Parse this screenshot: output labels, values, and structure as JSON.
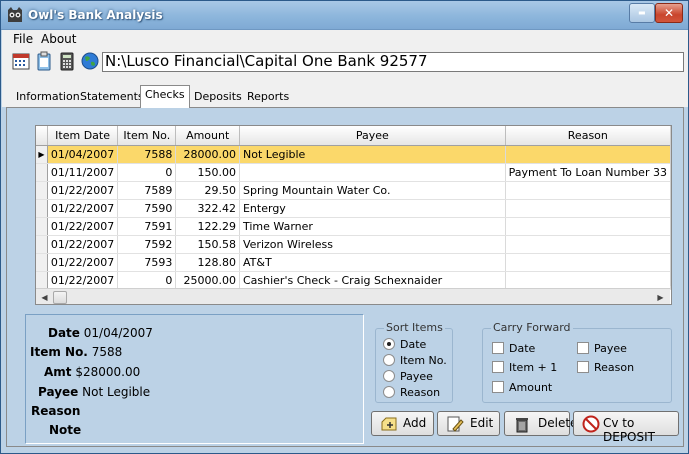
{
  "window": {
    "title": "Owl's Bank Analysis",
    "minimize_glyph": "▬",
    "close_glyph": "✕"
  },
  "menu": {
    "file": "File",
    "about": "About"
  },
  "toolbar": {
    "path": "N:\\Lusco Financial\\Capital One Bank 92577",
    "icons": [
      "calendar-icon",
      "clipboard-icon",
      "calculator-icon",
      "globe-icon"
    ]
  },
  "tabs": [
    "Information",
    "Statements",
    "Checks",
    "Deposits",
    "Reports"
  ],
  "active_tab": "Checks",
  "grid": {
    "columns": [
      "Item Date",
      "Item No.",
      "Amount",
      "Payee",
      "Reason"
    ],
    "selected_marker": "▶",
    "rows": [
      {
        "date": "01/04/2007",
        "no": "7588",
        "amount": "28000.00",
        "payee": "Not Legible",
        "reason": ""
      },
      {
        "date": "01/11/2007",
        "no": "0",
        "amount": "150.00",
        "payee": "",
        "reason": "Payment To Loan Number 33"
      },
      {
        "date": "01/22/2007",
        "no": "7589",
        "amount": "29.50",
        "payee": "Spring Mountain Water Co.",
        "reason": ""
      },
      {
        "date": "01/22/2007",
        "no": "7590",
        "amount": "322.42",
        "payee": "Entergy",
        "reason": ""
      },
      {
        "date": "01/22/2007",
        "no": "7591",
        "amount": "122.29",
        "payee": "Time Warner",
        "reason": ""
      },
      {
        "date": "01/22/2007",
        "no": "7592",
        "amount": "150.58",
        "payee": "Verizon Wireless",
        "reason": ""
      },
      {
        "date": "01/22/2007",
        "no": "7593",
        "amount": "128.80",
        "payee": "AT&T",
        "reason": ""
      },
      {
        "date": "01/22/2007",
        "no": "0",
        "amount": "25000.00",
        "payee": "Cashier's Check - Craig Schexnaider",
        "reason": ""
      }
    ],
    "scroll_up": "▲",
    "scroll_down": "▼",
    "scroll_left": "◀",
    "scroll_right": "▶"
  },
  "detail": {
    "date_label": "Date",
    "date_value": "01/04/2007",
    "item_label": "Item No.",
    "item_value": "7588",
    "amt_label": "Amt",
    "amt_value": "$28000.00",
    "payee_label": "Payee",
    "payee_value": "Not Legible",
    "reason_label": "Reason",
    "note_label": "Note"
  },
  "sort_items": {
    "title": "Sort Items",
    "options": [
      "Date",
      "Item No.",
      "Payee",
      "Reason"
    ],
    "selected": "Date"
  },
  "carry_forward": {
    "title": "Carry Forward",
    "options": [
      "Date",
      "Payee",
      "Item + 1",
      "Reason",
      "Amount"
    ]
  },
  "buttons": {
    "add": "Add",
    "edit": "Edit",
    "delete": "Delete",
    "cv": "Cv to DEPOSIT"
  },
  "colors": {
    "accent_selected_row": "#fbd86a",
    "panel": "#bcd2e6"
  }
}
